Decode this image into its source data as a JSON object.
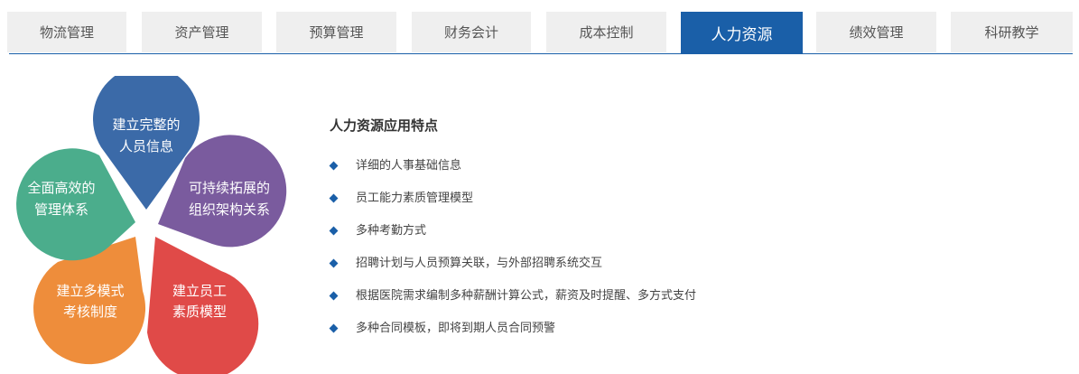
{
  "tabs": [
    {
      "label": "物流管理",
      "active": false
    },
    {
      "label": "资产管理",
      "active": false
    },
    {
      "label": "预算管理",
      "active": false
    },
    {
      "label": "财务会计",
      "active": false
    },
    {
      "label": "成本控制",
      "active": false
    },
    {
      "label": "人力资源",
      "active": true
    },
    {
      "label": "绩效管理",
      "active": false
    },
    {
      "label": "科研教学",
      "active": false
    }
  ],
  "flower": {
    "petals": [
      {
        "line1": "建立完整的",
        "line2": "人员信息",
        "color": "#3b6aa8"
      },
      {
        "line1": "可持续拓展的",
        "line2": "组织架构关系",
        "color": "#7a5b9e"
      },
      {
        "line1": "建立员工",
        "line2": "素质模型",
        "color": "#e04a48"
      },
      {
        "line1": "建立多模式",
        "line2": "考核制度",
        "color": "#ee8d3b"
      },
      {
        "line1": "全面高效的",
        "line2": "管理体系",
        "color": "#4bad8c"
      }
    ]
  },
  "features": {
    "title": "人力资源应用特点",
    "items": [
      "详细的人事基础信息",
      "员工能力素质管理模型",
      "多种考勤方式",
      "招聘计划与人员预算关联，与外部招聘系统交互",
      "根据医院需求编制多种薪酬计算公式，薪资及时提醒、多方式支付",
      "多种合同模板，即将到期人员合同预警"
    ]
  },
  "colors": {
    "accent": "#1a5fa8",
    "tab_bg": "#efefef"
  }
}
